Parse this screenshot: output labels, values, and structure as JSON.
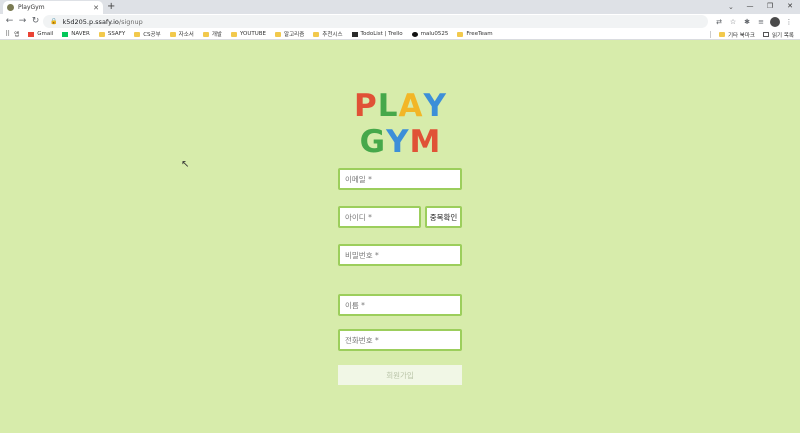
{
  "browser": {
    "tab_title": "PlayGym",
    "tab_close": "✕",
    "new_tab": "+",
    "tab_search": "⌄",
    "window_controls": [
      "—",
      "❐",
      "✕"
    ],
    "nav": {
      "back": "←",
      "forward": "→",
      "reload": "↻"
    },
    "url_host": "k5d205.p.ssafy.io",
    "url_path": "/signup",
    "lock_icon": "🔒",
    "bookmarks": [
      {
        "label": "앱",
        "icon": "apps-icon"
      },
      {
        "label": "Gmail",
        "icon": "gmail-icon"
      },
      {
        "label": "NAVER",
        "icon": "naver-icon"
      },
      {
        "label": "SSAFY",
        "icon": "folder-icon"
      },
      {
        "label": "CS공부",
        "icon": "folder-icon"
      },
      {
        "label": "자소서",
        "icon": "folder-icon"
      },
      {
        "label": "개발",
        "icon": "folder-icon"
      },
      {
        "label": "YOUTUBE",
        "icon": "folder-icon"
      },
      {
        "label": "알고리즘",
        "icon": "folder-icon"
      },
      {
        "label": "추천시스",
        "icon": "folder-icon"
      },
      {
        "label": "TodoList | Trello",
        "icon": "trello-icon"
      },
      {
        "label": "malu0525",
        "icon": "github-icon"
      },
      {
        "label": "FreeTeam",
        "icon": "folder-icon"
      }
    ],
    "other_bookmarks": "기타 북마크",
    "reading_list": "읽기 목록"
  },
  "logo": {
    "row1": [
      "P",
      "L",
      "A",
      "Y"
    ],
    "row2": [
      "G",
      "Y",
      "M"
    ],
    "colors_row1": [
      "#e05236",
      "#46a84a",
      "#f2b627",
      "#3c8fd8"
    ],
    "colors_row2": [
      "#46a84a",
      "#3c8fd8",
      "#e05236"
    ]
  },
  "form": {
    "email_placeholder": "이메일 *",
    "id_placeholder": "아이디 *",
    "dup_check_label": "중복확인",
    "password_placeholder": "비밀번호 *",
    "name_placeholder": "이름 *",
    "phone_placeholder": "전화번호 *",
    "submit_label": "회원가입"
  },
  "colors": {
    "page_background": "#d7ecab",
    "field_border": "#9cce5c",
    "submit_background": "#f1f7e6"
  }
}
